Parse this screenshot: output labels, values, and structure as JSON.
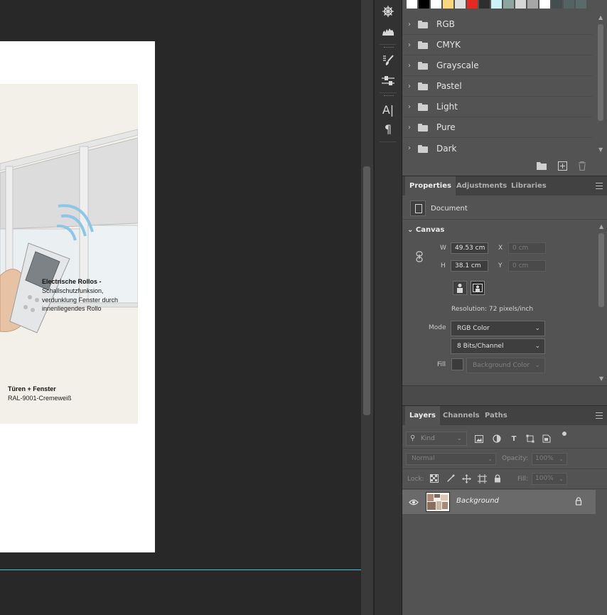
{
  "document": {
    "caption_title": "Electrische Rollos -",
    "caption_body": "Schallschutzfunksion, verdunklung Fenster durch innenliegendes Rollo",
    "label_title": "Türen + Fenster",
    "label_sub": "RAL-9001-Cremeweiß"
  },
  "tools": {
    "icons": [
      "wheel-icon",
      "histogram-icon",
      "brush-presets-icon",
      "adjust-sliders-icon",
      "character-icon",
      "paragraph-icon"
    ],
    "character_glyph": "A|",
    "paragraph_glyph": "¶"
  },
  "swatches": {
    "colors": [
      "#ffffff",
      "#000000",
      "#ffffff",
      "#fad67f",
      "#e0e0e0",
      "#e32b23",
      "#2e2e2e",
      "#ccf3f7",
      "#8ea4a0",
      "#d6d6d6",
      "#a6a6a6",
      "#ffffff",
      "#444e4e",
      "#536262",
      "#5a6a6a"
    ],
    "folders": [
      {
        "name": "RGB"
      },
      {
        "name": "CMYK"
      },
      {
        "name": "Grayscale"
      },
      {
        "name": "Pastel"
      },
      {
        "name": "Light"
      },
      {
        "name": "Pure"
      },
      {
        "name": "Dark"
      }
    ],
    "chevron": "›"
  },
  "properties": {
    "tabs": [
      {
        "label": "Properties",
        "active": true
      },
      {
        "label": "Adjustments",
        "active": false
      },
      {
        "label": "Libraries",
        "active": false
      }
    ],
    "doc_label": "Document",
    "canvas_heading": "Canvas",
    "w_label": "W",
    "w_value": "49.53 cm",
    "h_label": "H",
    "h_value": "38.1 cm",
    "x_label": "X",
    "x_placeholder": "0 cm",
    "y_label": "Y",
    "y_placeholder": "0 cm",
    "resolution": "Resolution: 72 pixels/inch",
    "mode_label": "Mode",
    "mode_value": "RGB Color",
    "bits_value": "8 Bits/Channel",
    "fill_label": "Fill",
    "fill_value": "Background Color"
  },
  "layers": {
    "tabs": [
      {
        "label": "Layers",
        "active": true
      },
      {
        "label": "Channels",
        "active": false
      },
      {
        "label": "Paths",
        "active": false
      }
    ],
    "kind_placeholder": "Kind",
    "blend_mode": "Normal",
    "opacity_label": "Opacity:",
    "opacity_value": "100%",
    "lock_label": "Lock:",
    "fill_label": "Fill:",
    "fill_value": "100%",
    "items": [
      {
        "name": "Background",
        "locked": true
      }
    ]
  },
  "colors": {
    "guide": "#4fb9d3",
    "panel": "#535353",
    "canvas_bg": "#282828"
  }
}
